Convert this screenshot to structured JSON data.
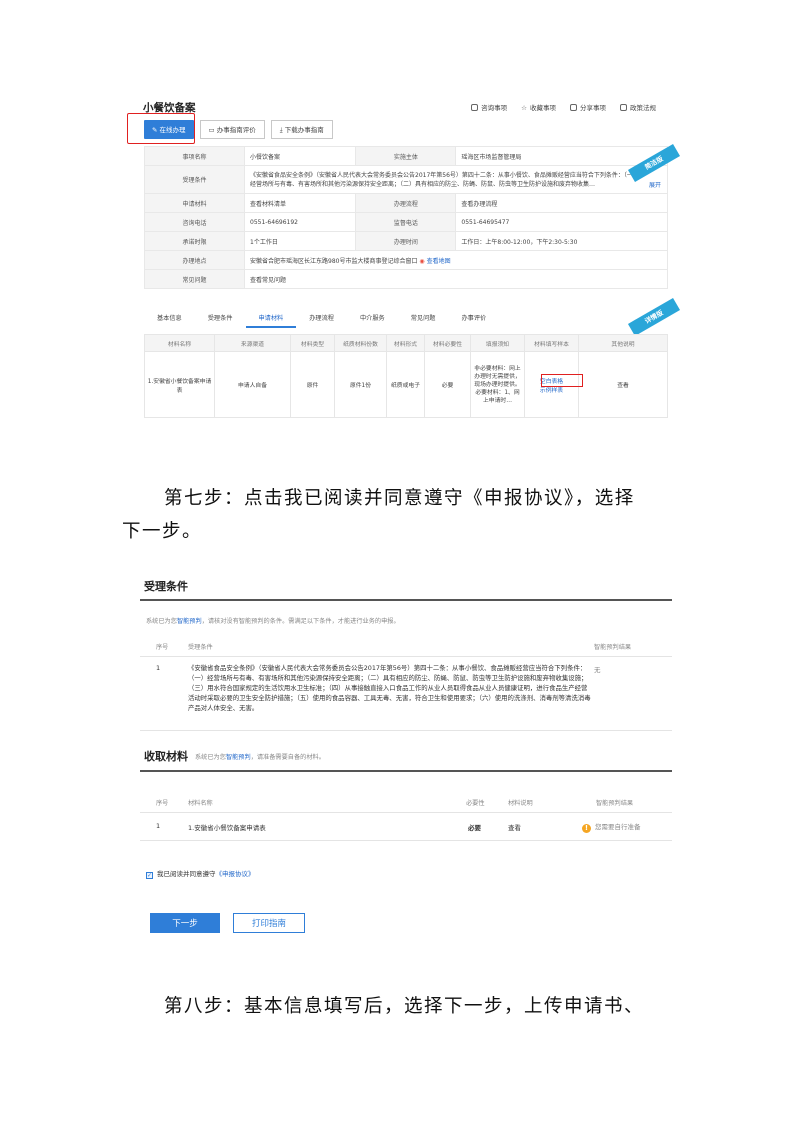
{
  "shot1": {
    "title": "小餐饮备案",
    "actions": [
      "咨询事项",
      "收藏事项",
      "分享事项",
      "政策法规"
    ],
    "buttons": {
      "online": "在线办理",
      "guide_eval": "办事指南评价",
      "download": "下载办事指南"
    },
    "ribbon_quick": "简洁版",
    "ribbon_detail": "详情版",
    "info": {
      "item_name_label": "事项名称",
      "item_name": "小餐饮备案",
      "impl_label": "实施主体",
      "impl": "瑶海区市场监督管理局",
      "cond_label": "受理条件",
      "cond": "《安徽省食品安全条例》（安徽省人民代表大会常务委员会公告2017年第56号）第四十二条：从事小餐饮、食品摊贩经营应当符合下列条件：（一）经营场所与有毒、有害场所和其他污染源保持安全距离；（二）具有相应的防尘、防蝇、防鼠、防虫等卫生防护设施和废弃物收集…",
      "expand": "展开",
      "material_label": "申请材料",
      "material": "查看材料清单",
      "flow_label": "办理流程",
      "flow": "查看办理流程",
      "phone_label": "咨询电话",
      "phone": "0551-64696192",
      "supervise_label": "监督电话",
      "supervise": "0551-64695477",
      "promise_label": "承诺时限",
      "promise": "1个工作日",
      "hours_label": "办理时间",
      "hours": "工作日：上午8:00-12:00，下午2:30-5:30",
      "place_label": "办理地点",
      "place": "安徽省合肥市瑶海区长江东路980号市监大楼商事登记综合窗口",
      "map": "查看地图",
      "faq_label": "常见问题",
      "faq": "查看常见问题"
    },
    "tabs": [
      "基本信息",
      "受理条件",
      "申请材料",
      "办理流程",
      "中介服务",
      "常见问题",
      "办事评价"
    ],
    "table_headers": [
      "材料名称",
      "来源渠道",
      "材料类型",
      "纸质材料份数",
      "材料形式",
      "材料必要性",
      "填报须知",
      "材料填写样本",
      "其他说明"
    ],
    "table_row": {
      "name": "1.安徽省小餐饮备案申请表",
      "source": "申请人自备",
      "type": "原件",
      "copies": "原件1份",
      "form": "纸质或电子",
      "need": "必要",
      "notes": "非必要材料：网上办理时无需提供，现场办理时提供。必要材料：1、网上申请时…",
      "blank": "空白表格",
      "sample": "示例样表",
      "other": "查看"
    }
  },
  "para1_line1": "第七步：点击我已阅读并同意遵守《申报协议》，选择",
  "para1_line2": "下一步。",
  "shot2": {
    "cond_title": "受理条件",
    "cond_note_pre": "系统已为您",
    "cond_note_link": "智能预判",
    "cond_note_post": "，请核对没有智能预判的条件。需满足以下条件，才能进行业务的申报。",
    "col_seq": "序号",
    "col_cond": "受理条件",
    "col_result": "智能预判结果",
    "cond_seq": "1",
    "cond_text": "《安徽省食品安全条例》（安徽省人民代表大会常务委员会公告2017年第56号）第四十二条：从事小餐饮、食品摊贩经营应当符合下列条件：（一）经营场所与有毒、有害场所和其他污染源保持安全距离；（二）具有相应的防尘、防蝇、防鼠、防虫等卫生防护设施和废弃物收集设施；（三）用水符合国家规定的生活饮用水卫生标准；（四）从事接触直接入口食品工作的从业人员取得食品从业人员健康证明，进行食品生产经营活动时采取必要的卫生安全防护措施；（五）使用的食品容器、工具无毒、无害，符合卫生和使用要求；（六）使用的洗涤剂、消毒剂等清洗消毒产品对人体安全、无害。",
    "cond_result": "无",
    "mat_title": "收取材料",
    "mat_note_pre": "系统已为您",
    "mat_note_link": "智能预判",
    "mat_note_post": "，请准备需要自备的材料。",
    "col_mat_name": "材料名称",
    "col_need": "必要性",
    "col_desc": "材料说明",
    "mat_seq": "1",
    "mat_name": "1.安徽省小餐饮备案申请表",
    "mat_need": "必要",
    "mat_desc": "查看",
    "mat_result": "您需要自行准备",
    "agree_pre": "我已阅读并同意遵守",
    "agree_link": "《申报协议》",
    "next": "下一步",
    "print": "打印指南"
  },
  "para2": "第八步：基本信息填写后，选择下一步，上传申请书、"
}
